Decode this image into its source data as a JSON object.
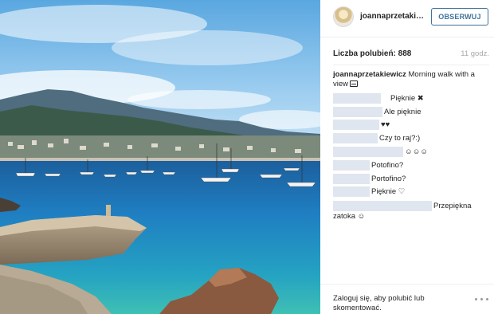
{
  "post": {
    "username": "joannaprzetakiewicz",
    "follow_label": "OBSERWUJ",
    "likes_label": "Liczba polubień: 888",
    "time": "11 godz.",
    "caption_author": "joannaprzetakiewicz",
    "caption_text": " Morning walk with a view"
  },
  "comments": [
    {
      "text": "Pięknie ✖"
    },
    {
      "text": "Ale pięknie"
    },
    {
      "text": "♥♥"
    },
    {
      "text": "Czy to raj?:)"
    },
    {
      "text": "☺☺☺"
    },
    {
      "text": "Potofino?"
    },
    {
      "text": "Portofino?"
    },
    {
      "text": "Pięknie ♡"
    },
    {
      "text": "Przepiękna"
    },
    {
      "text": "zatoka ☺"
    }
  ],
  "footer": {
    "login_text": "Zaloguj się, aby polubić lub skomentować.",
    "more_icon": "more-options-icon"
  },
  "colors": {
    "accent": "#3f729b",
    "sea": "#1f7fc2",
    "sky": "#86c1ea"
  }
}
